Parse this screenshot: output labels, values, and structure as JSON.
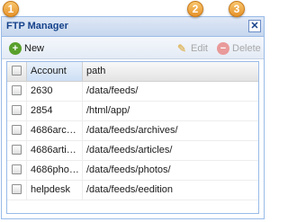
{
  "window": {
    "title": "FTP Manager",
    "close_glyph": "✕"
  },
  "toolbar": {
    "new_label": "New",
    "new_icon": "add-icon",
    "edit_label": "Edit",
    "edit_icon": "pencil-icon",
    "delete_label": "Delete",
    "delete_icon": "remove-icon"
  },
  "grid": {
    "columns": [
      "Account",
      "path"
    ],
    "rows": [
      {
        "account": "2630",
        "path": "/data/feeds/"
      },
      {
        "account": "2854",
        "path": "/html/app/"
      },
      {
        "account": "4686arc…",
        "path": "/data/feeds/archives/"
      },
      {
        "account": "4686arti…",
        "path": "/data/feeds/articles/"
      },
      {
        "account": "4686pho…",
        "path": "/data/feeds/photos/"
      },
      {
        "account": "helpdesk",
        "path": "/data/feeds/eedition"
      }
    ]
  },
  "callouts": [
    "1",
    "2",
    "3"
  ],
  "colors": {
    "accent": "#15428b",
    "border": "#99bbe8",
    "badge": "#f0a640",
    "new_icon": "#5aa02c",
    "delete_icon": "#e99a9a"
  }
}
